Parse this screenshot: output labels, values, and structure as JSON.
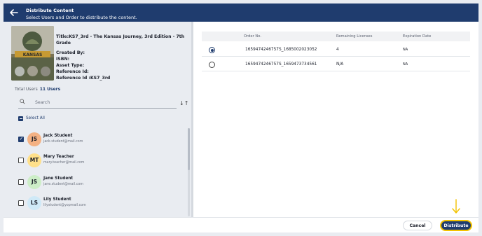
{
  "header": {
    "title": "Distribute Content",
    "subtitle": "Select Users and Order to distribute the content."
  },
  "book": {
    "title": "Title:KS7_3rd - The Kansas Journey, 3rd Edition - 7th Grade",
    "created_by": "Created By:",
    "isbn": "ISBN:",
    "asset_type": "Asset Type:",
    "reference_id": "Reference Id:",
    "reference_id_value": "Reference Id :KS7_3rd",
    "cover_banner_text": "KANSAS"
  },
  "users_panel": {
    "total_label": "Total Users",
    "total_count": "11 Users",
    "search_placeholder": "Search",
    "sort_icon": "sort-az-icon",
    "select_all_label": "Select All",
    "users": [
      {
        "initials": "JS",
        "name": "Jack Student",
        "email": "jack.student@mail.com",
        "checked": true,
        "avatar_color": "#f4b183"
      },
      {
        "initials": "MT",
        "name": "Mary Teacher",
        "email": "mary.teacher@mail.com",
        "checked": false,
        "avatar_color": "#ffe08a"
      },
      {
        "initials": "JS",
        "name": "Jane Student",
        "email": "jane.student@mail.com",
        "checked": false,
        "avatar_color": "#cdeec7"
      },
      {
        "initials": "LS",
        "name": "Lily Student",
        "email": "lilystudent@yopmail.com",
        "checked": false,
        "avatar_color": "#cfe9f7"
      }
    ]
  },
  "orders_table": {
    "columns": [
      "Order No.",
      "Remaining Licenses",
      "Expiration Date"
    ],
    "rows": [
      {
        "order_no": "1659474246757S_1685002023052",
        "remaining": "4",
        "expiration": "NA",
        "selected": true
      },
      {
        "order_no": "1659474246757S_1659473734561",
        "remaining": "N/A",
        "expiration": "NA",
        "selected": false
      }
    ]
  },
  "footer": {
    "cancel_label": "Cancel",
    "distribute_label": "Distribute"
  },
  "colors": {
    "brand": "#1f3c6e",
    "highlight": "#f2c200",
    "background": "#e9ecf1"
  }
}
